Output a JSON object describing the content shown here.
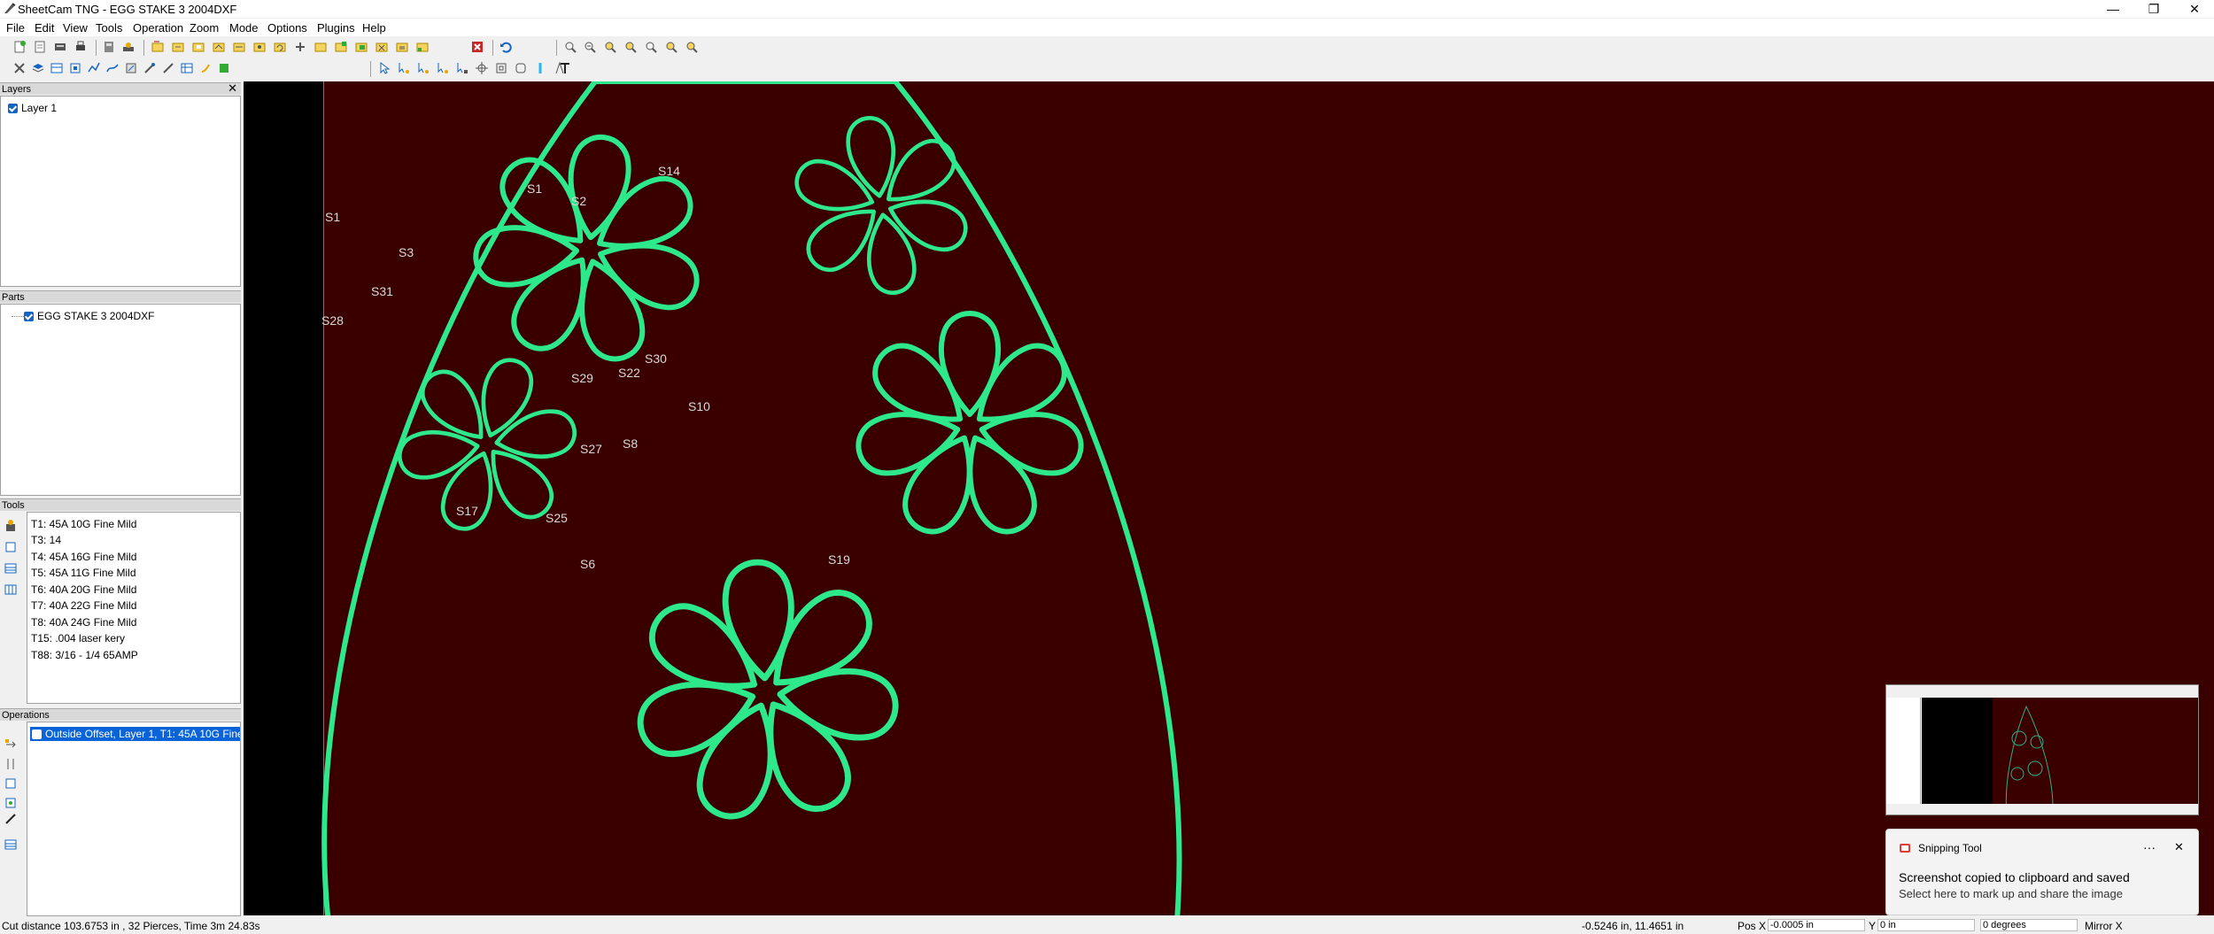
{
  "window": {
    "title": "SheetCam TNG - EGG STAKE 3 2004DXF",
    "minimize": "—",
    "maximize": "❐",
    "close": "✕"
  },
  "menu": [
    "File",
    "Edit",
    "View",
    "Tools",
    "Operation",
    "Zoom",
    "Mode",
    "Options",
    "Plugins",
    "Help"
  ],
  "panels": {
    "layers": {
      "title": "Layers",
      "items": [
        {
          "label": "Layer 1",
          "checked": true
        }
      ]
    },
    "parts": {
      "title": "Parts",
      "items": [
        {
          "label": "EGG STAKE 3 2004DXF",
          "checked": true
        }
      ]
    },
    "tools": {
      "title": "Tools",
      "items": [
        "T1: 45A 10G Fine Mild",
        "T3: 14",
        "T4: 45A 16G Fine Mild",
        "T5: 45A 11G Fine Mild",
        "T6: 40A 20G Fine Mild",
        "T7: 40A 22G Fine Mild",
        "T8: 40A 24G Fine Mild",
        "T15: .004 laser kery",
        "T88: 3/16 - 1/4 65AMP"
      ]
    },
    "operations": {
      "title": "Operations",
      "items": [
        {
          "label": "Outside Offset, Layer 1, T1: 45A 10G Fine ...",
          "checked": true,
          "selected": true
        }
      ]
    }
  },
  "canvas": {
    "background": "#3a0000",
    "path_color": "#2ee88c",
    "labels": [
      "S14",
      "S1",
      "S3",
      "S31",
      "S28",
      "S1",
      "S2",
      "S22",
      "S30",
      "S29",
      "S10",
      "S27",
      "S8",
      "S17",
      "S25",
      "S6",
      "S19"
    ]
  },
  "status": {
    "left": "Cut distance 103.6753 in , 32 Pierces, Time 3m 24.83s",
    "coords": "-0.5246 in, 11.4651 in",
    "pos_x_label": "Pos X",
    "pos_x": "-0.0005 in",
    "y_label": "Y",
    "y": "0 in",
    "angle": "0 degrees",
    "mirror": "Mirror X"
  },
  "toast": {
    "app": "Snipping Tool",
    "more": "···",
    "close": "✕",
    "headline": "Screenshot copied to clipboard and saved",
    "body": "Select here to mark up and share the image"
  }
}
